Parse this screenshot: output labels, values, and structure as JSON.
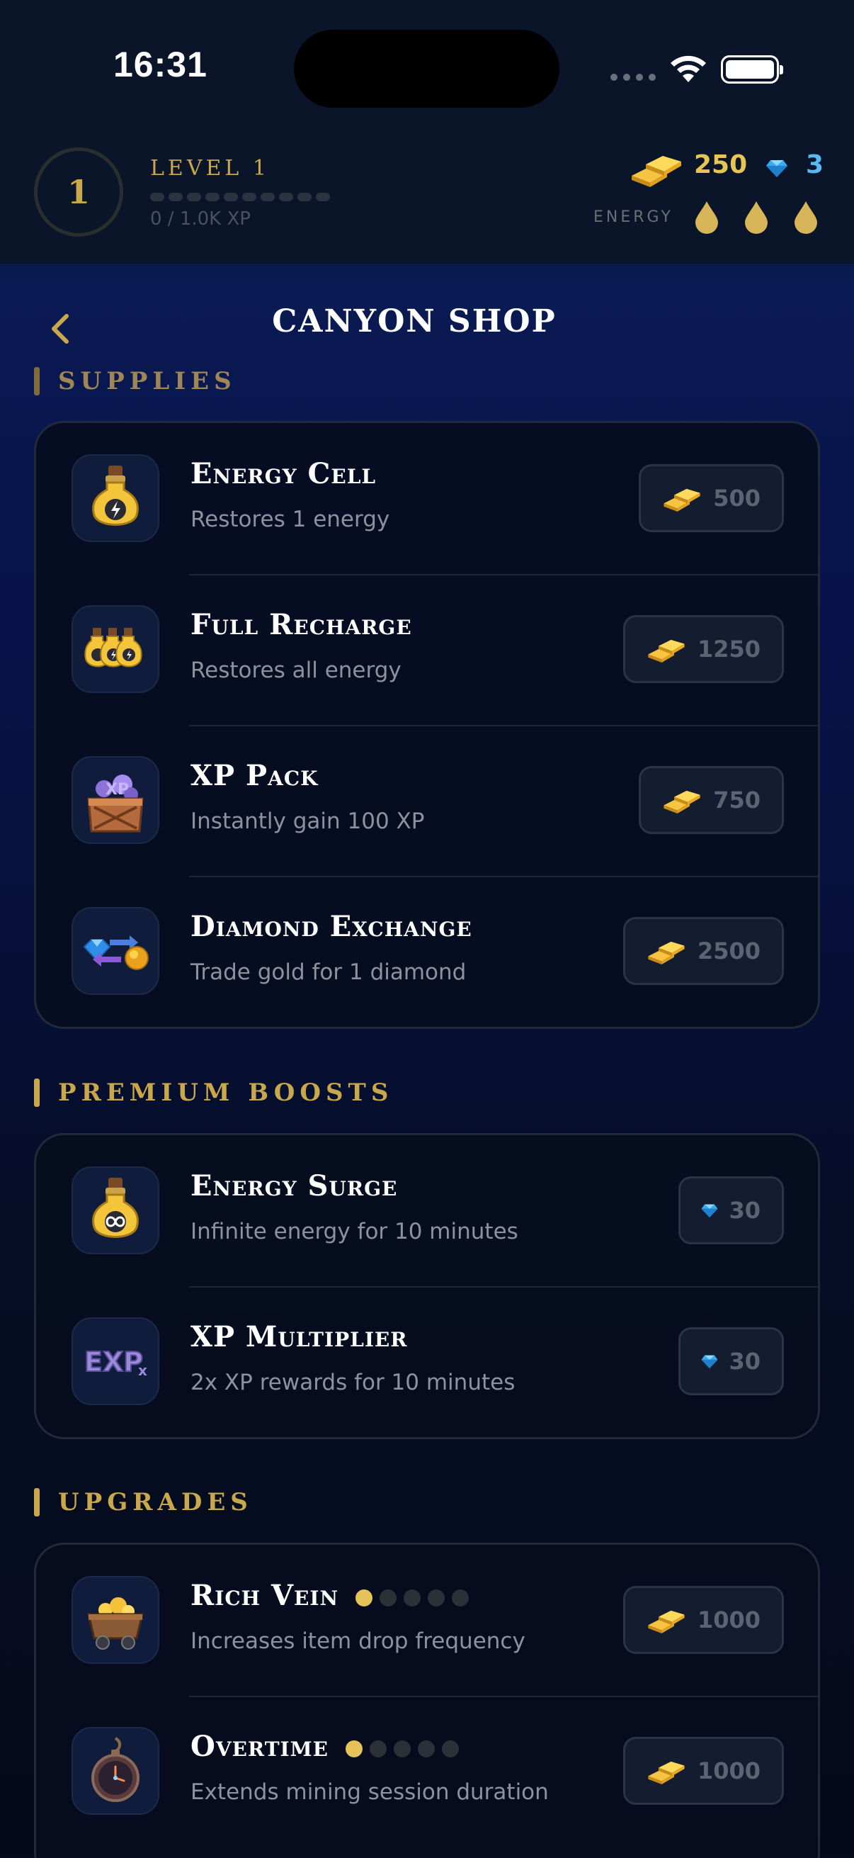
{
  "status_bar": {
    "time": "16:31"
  },
  "hud": {
    "level_number": "1",
    "level_label": "LEVEL 1",
    "xp_text": "0 / 1.0K XP",
    "gold_amount": "250",
    "diamond_amount": "3",
    "energy_label": "ENERGY",
    "energy_drops": 3
  },
  "nav": {
    "title": "CANYON SHOP",
    "back_icon": "chevron-left-icon"
  },
  "sections": {
    "supplies": {
      "title": "SUPPLIES",
      "items": [
        {
          "name": "Energy Cell",
          "desc": "Restores 1 energy",
          "price": "500",
          "currency": "gold",
          "icon": "potion-bolt-icon"
        },
        {
          "name": "Full Recharge",
          "desc": "Restores all energy",
          "price": "1250",
          "currency": "gold",
          "icon": "triple-potion-icon"
        },
        {
          "name": "XP Pack",
          "desc": "Instantly gain 100 XP",
          "price": "750",
          "currency": "gold",
          "icon": "xp-crate-icon"
        },
        {
          "name": "Diamond Exchange",
          "desc": "Trade gold for 1 diamond",
          "price": "2500",
          "currency": "gold",
          "icon": "exchange-icon"
        }
      ]
    },
    "premium": {
      "title": "PREMIUM BOOSTS",
      "items": [
        {
          "name": "Energy Surge",
          "desc": "Infinite energy for 10 minutes",
          "price": "30",
          "currency": "diamond",
          "icon": "potion-infinity-icon"
        },
        {
          "name": "XP Multiplier",
          "desc": "2x XP rewards for 10 minutes",
          "price": "30",
          "currency": "diamond",
          "icon": "exp-multiplier-icon"
        }
      ]
    },
    "upgrades": {
      "title": "UPGRADES",
      "items": [
        {
          "name": "Rich Vein",
          "desc": "Increases item drop frequency",
          "price": "1000",
          "currency": "gold",
          "icon": "mine-cart-icon",
          "level": 1,
          "max_level": 5
        },
        {
          "name": "Overtime",
          "desc": "Extends mining session duration",
          "price": "1000",
          "currency": "gold",
          "icon": "pocket-watch-icon",
          "level": 1,
          "max_level": 5
        }
      ]
    }
  },
  "colors": {
    "accent_gold": "#c9a84c",
    "gold_text": "#e7c555",
    "diamond_text": "#59b9ee"
  }
}
